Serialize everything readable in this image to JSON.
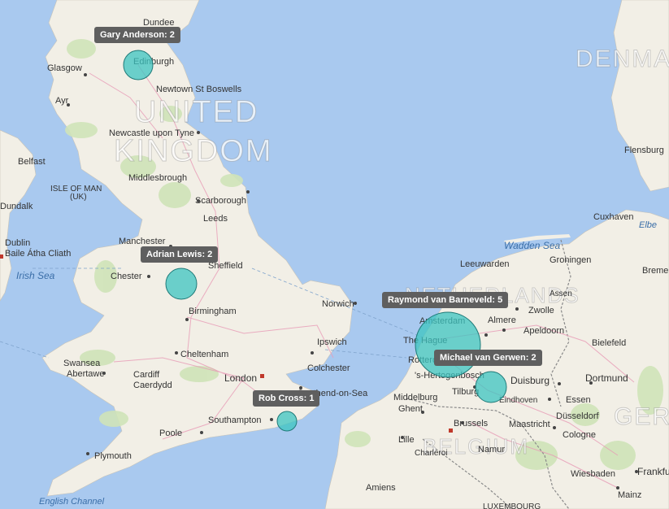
{
  "map": {
    "countries": [
      "UNITED",
      "KINGDOM",
      "DENMA",
      "NETHERLANDS",
      "BELGIUM",
      "GER"
    ],
    "seas": [
      "Irish Sea",
      "Wadden Sea",
      "English Channel"
    ],
    "places": [
      "Dundee",
      "Glasgow",
      "Edinburgh",
      "Ayr",
      "Newtown St Boswells",
      "Newcastle upon Tyne",
      "Belfast",
      "ISLE OF MAN",
      "(UK)",
      "Dundalk",
      "Middlesbrough",
      "Scarborough",
      "Leeds",
      "Manchester",
      "Dublin",
      "Baile Átha Cliath",
      "Chester",
      "Sheffield",
      "Birmingham",
      "Norwich",
      "Ipswich",
      "Cheltenham",
      "Colchester",
      "Swansea",
      "Abertawe",
      "Cardiff",
      "Caerdydd",
      "London",
      "Southend-on-Sea",
      "Southampton",
      "Poole",
      "Plymouth",
      "Flensburg",
      "Cuxhaven",
      "Elbe",
      "Bremen",
      "Leeuwarden",
      "Groningen",
      "Assen",
      "Zwolle",
      "Almere",
      "Apeldoorn",
      "Amsterdam",
      "The Hague",
      "Rotterdam",
      "'s-Hertogenbosch",
      "Bielefeld",
      "Dortmund",
      "Duisburg",
      "Essen",
      "Düsseldorf",
      "Middelburg",
      "Tilburg",
      "Eindhoven",
      "Ghent",
      "Brussels",
      "Maastricht",
      "Cologne",
      "Lille",
      "Charleroi",
      "Namur",
      "Amiens",
      "Wiesbaden",
      "Frankfurt",
      "Mainz",
      "LUXEMBOURG"
    ]
  },
  "tooltips": {
    "gary": "Gary Anderson: 2",
    "adrian": "Adrian Lewis: 2",
    "raymond": "Raymond van Barneveld: 5",
    "michael": "Michael van Gerwen: 2",
    "rob": "Rob Cross: 1"
  },
  "bubbles": [
    {
      "player": "Gary Anderson",
      "value": 2
    },
    {
      "player": "Adrian Lewis",
      "value": 2
    },
    {
      "player": "Raymond van Barneveld",
      "value": 5
    },
    {
      "player": "Michael van Gerwen",
      "value": 2
    },
    {
      "player": "Rob Cross",
      "value": 1
    }
  ],
  "colors": {
    "water": "#a9c9ef",
    "land": "#f2efe6",
    "bubble": "#3cc4c0"
  }
}
